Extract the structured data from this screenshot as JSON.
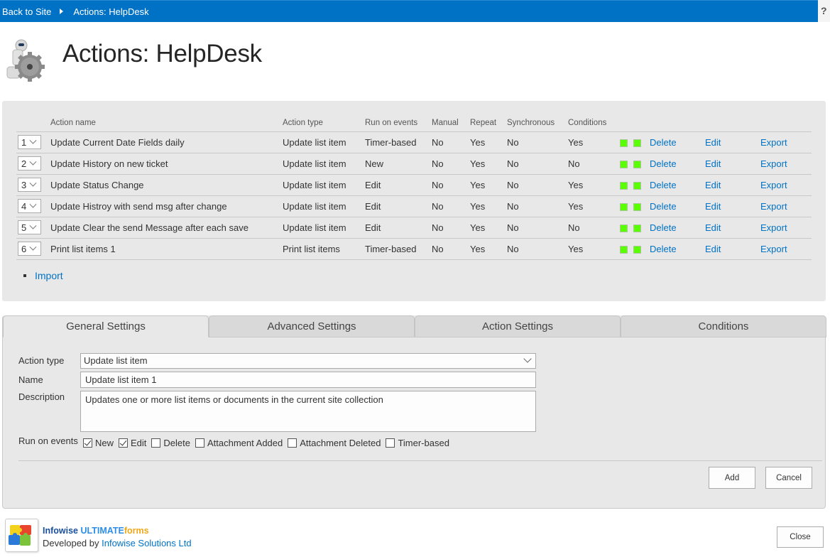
{
  "topbar": {
    "back_label": "Back to Site",
    "current_label": "Actions: HelpDesk",
    "help_label": "?"
  },
  "header": {
    "title": "Actions: HelpDesk"
  },
  "actions_table": {
    "headers": [
      "",
      "Action name",
      "Action type",
      "Run on events",
      "Manual",
      "Repeat",
      "Synchronous",
      "Conditions"
    ],
    "rows": [
      {
        "order": "1",
        "name": "Update Current Date Fields daily",
        "type": "Update list item",
        "events": "Timer-based",
        "manual": "No",
        "repeat": "Yes",
        "synchronous": "No",
        "conditions": "Yes",
        "delete": "Delete",
        "edit": "Edit",
        "export": "Export"
      },
      {
        "order": "2",
        "name": "Update History on new ticket",
        "type": "Update list item",
        "events": "New",
        "manual": "No",
        "repeat": "Yes",
        "synchronous": "No",
        "conditions": "No",
        "delete": "Delete",
        "edit": "Edit",
        "export": "Export"
      },
      {
        "order": "3",
        "name": "Update Status Change",
        "type": "Update list item",
        "events": "Edit",
        "manual": "No",
        "repeat": "Yes",
        "synchronous": "No",
        "conditions": "Yes",
        "delete": "Delete",
        "edit": "Edit",
        "export": "Export"
      },
      {
        "order": "4",
        "name": "Update Histroy with send msg after change",
        "type": "Update list item",
        "events": "Edit",
        "manual": "No",
        "repeat": "Yes",
        "synchronous": "No",
        "conditions": "Yes",
        "delete": "Delete",
        "edit": "Edit",
        "export": "Export"
      },
      {
        "order": "5",
        "name": "Update Clear the send Message after each save",
        "type": "Update list item",
        "events": "Edit",
        "manual": "No",
        "repeat": "Yes",
        "synchronous": "No",
        "conditions": "No",
        "delete": "Delete",
        "edit": "Edit",
        "export": "Export"
      },
      {
        "order": "6",
        "name": "Print list items 1",
        "type": "Print list items",
        "events": "Timer-based",
        "manual": "No",
        "repeat": "Yes",
        "synchronous": "No",
        "conditions": "Yes",
        "delete": "Delete",
        "edit": "Edit",
        "export": "Export"
      }
    ],
    "status_color": "#5aff00",
    "import_label": "Import"
  },
  "tabs": [
    {
      "label": "General Settings",
      "active": true
    },
    {
      "label": "Advanced Settings",
      "active": false
    },
    {
      "label": "Action Settings",
      "active": false
    },
    {
      "label": "Conditions",
      "active": false
    }
  ],
  "form": {
    "action_type_label": "Action type",
    "action_type_value": "Update list item",
    "name_label": "Name",
    "name_value": "Update list item 1",
    "description_label": "Description",
    "description_value": "Updates one or more list items or documents in the current site collection",
    "run_on_events_label": "Run on events",
    "events": [
      {
        "label": "New",
        "checked": true
      },
      {
        "label": "Edit",
        "checked": true
      },
      {
        "label": "Delete",
        "checked": false
      },
      {
        "label": "Attachment Added",
        "checked": false
      },
      {
        "label": "Attachment Deleted",
        "checked": false
      },
      {
        "label": "Timer-based",
        "checked": false
      }
    ],
    "add_label": "Add",
    "cancel_label": "Cancel"
  },
  "footer": {
    "brand_part1": "Infowise ",
    "brand_part2": "ULTIMATE",
    "brand_part3": "forms",
    "developed_by": "Developed by ",
    "developer_link": "Infowise Solutions Ltd",
    "close_label": "Close"
  },
  "colors": {
    "topbar": "#0072c6",
    "link": "#0072c6",
    "panel": "#e8e8e8"
  }
}
